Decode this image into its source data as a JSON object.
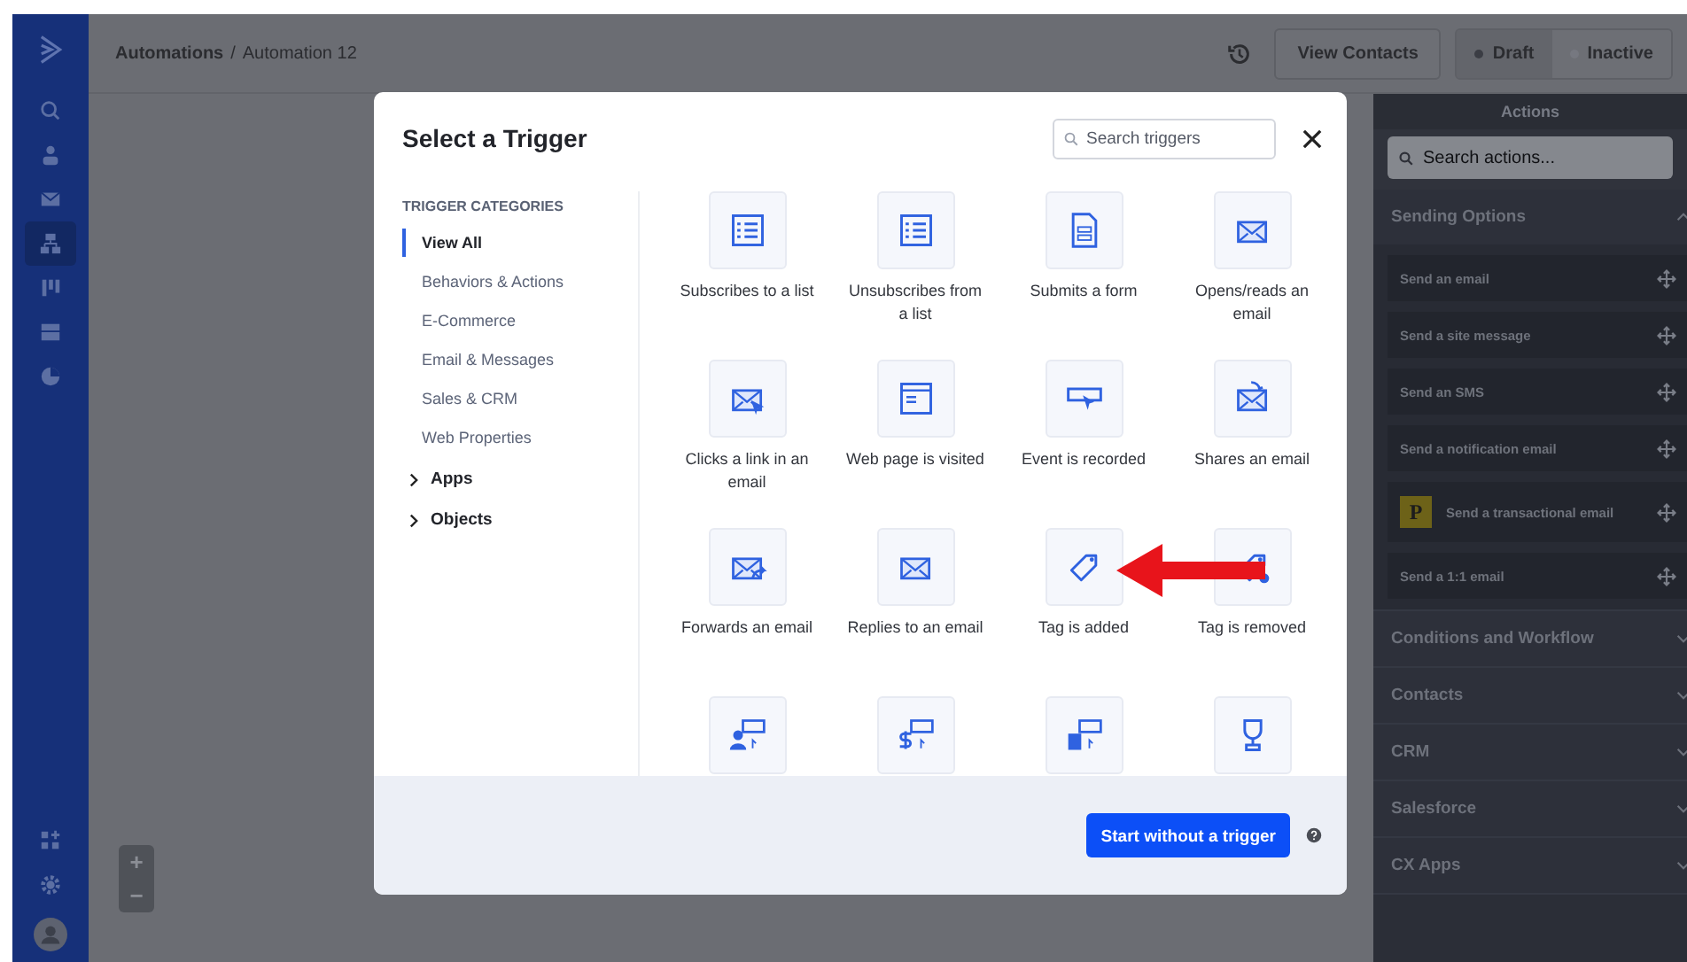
{
  "breadcrumb": {
    "parent": "Automations",
    "separator": "/",
    "current": "Automation 12"
  },
  "header_buttons": {
    "view_contacts": "View Contacts",
    "status": [
      {
        "label": "Draft",
        "selected": true
      },
      {
        "label": "Inactive",
        "selected": false
      }
    ]
  },
  "zoom_controls": [
    "+",
    "−"
  ],
  "actions_panel": {
    "title": "Actions",
    "search": {
      "placeholder": "Search actions..."
    },
    "sections": [
      {
        "title": "Sending Options",
        "expanded": true,
        "items": [
          {
            "kind": "plain",
            "label": "Send an email"
          },
          {
            "kind": "plain",
            "label": "Send a site message"
          },
          {
            "kind": "plain",
            "label": "Send an SMS"
          },
          {
            "kind": "plain",
            "label": "Send a notification email"
          },
          {
            "kind": "badge",
            "badge": "P",
            "label": "Send a transactional email"
          },
          {
            "kind": "plain",
            "label": "Send a 1:1 email"
          }
        ]
      },
      {
        "title": "Conditions and Workflow",
        "expanded": false
      },
      {
        "title": "Contacts",
        "expanded": false
      },
      {
        "title": "CRM",
        "expanded": false
      },
      {
        "title": "Salesforce",
        "expanded": false
      },
      {
        "title": "CX Apps",
        "expanded": false
      }
    ]
  },
  "modal": {
    "title": "Select a Trigger",
    "search": {
      "placeholder": "Search triggers"
    },
    "categories_heading": "TRIGGER CATEGORIES",
    "categories": [
      {
        "label": "View All",
        "selected": true
      },
      {
        "label": "Behaviors & Actions",
        "selected": false
      },
      {
        "label": "E-Commerce",
        "selected": false
      },
      {
        "label": "Email & Messages",
        "selected": false
      },
      {
        "label": "Sales & CRM",
        "selected": false
      },
      {
        "label": "Web Properties",
        "selected": false
      }
    ],
    "groups": [
      {
        "label": "Apps",
        "expanded": false
      },
      {
        "label": "Objects",
        "expanded": false
      }
    ],
    "triggers": [
      {
        "kind": "labeled",
        "label": "Subscribes to a list"
      },
      {
        "kind": "labeled",
        "label": "Unsubscribes from a list"
      },
      {
        "kind": "labeled",
        "label": "Submits a form"
      },
      {
        "kind": "labeled",
        "label": "Opens/reads an email"
      },
      {
        "kind": "labeled",
        "label": "Clicks a link in an email"
      },
      {
        "kind": "labeled",
        "label": "Web page is visited"
      },
      {
        "kind": "labeled",
        "label": "Event is recorded"
      },
      {
        "kind": "labeled",
        "label": "Shares an email"
      },
      {
        "kind": "labeled",
        "label": "Forwards an email"
      },
      {
        "kind": "labeled",
        "label": "Replies to an email"
      },
      {
        "kind": "labeled",
        "label": "Tag is added"
      },
      {
        "kind": "labeled",
        "label": "Tag is removed"
      },
      {
        "kind": "cut_off"
      },
      {
        "kind": "cut_off"
      },
      {
        "kind": "cut_off"
      },
      {
        "kind": "cut_off"
      }
    ],
    "footer_button": "Start without a trigger"
  }
}
